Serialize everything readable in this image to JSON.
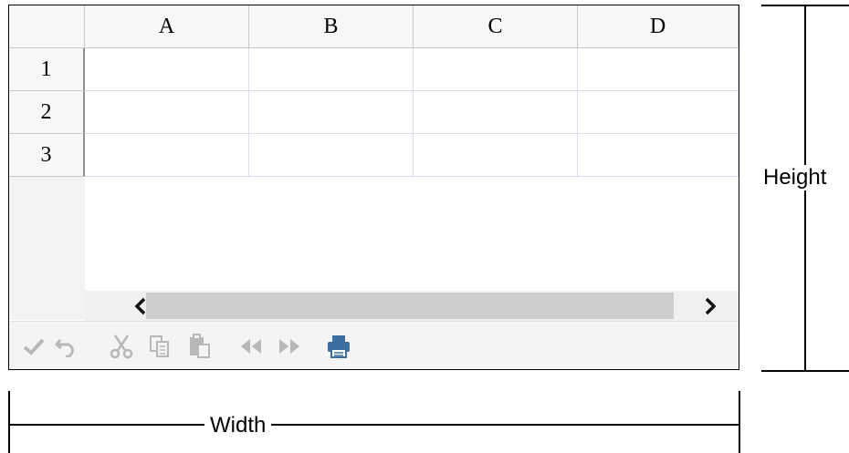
{
  "grid": {
    "columns": [
      "A",
      "B",
      "C",
      "D"
    ],
    "rows": [
      "1",
      "2",
      "3"
    ]
  },
  "toolbar": {
    "icons": [
      "checkmark-icon",
      "undo-icon",
      "cut-icon",
      "copy-icon",
      "paste-icon",
      "rewind-icon",
      "fast-forward-icon",
      "print-icon"
    ],
    "print_color": "#3a6fa0",
    "disabled_color": "#b8b8b8"
  },
  "dimensions": {
    "width_label": "Width",
    "height_label": "Height"
  }
}
